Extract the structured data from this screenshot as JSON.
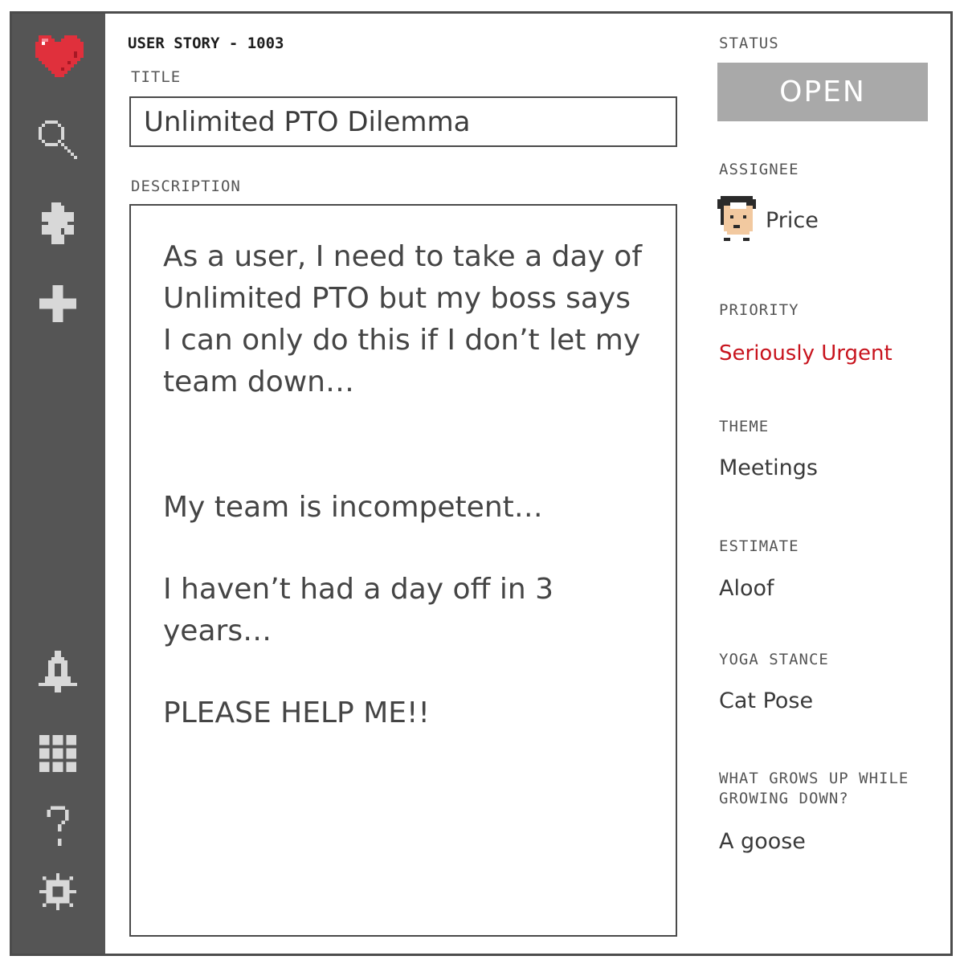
{
  "story": {
    "id": "USER STORY - 1003"
  },
  "labels": {
    "title": "TITLE",
    "description": "DESCRIPTION",
    "status": "STATUS",
    "assignee": "ASSIGNEE",
    "priority": "PRIORITY",
    "theme": "THEME",
    "estimate": "ESTIMATE",
    "yoga_stance": "YOGA STANCE",
    "riddle_line1": "WHAT GROWS UP WHILE",
    "riddle_line2": "GROWING DOWN?"
  },
  "fields": {
    "title": "Unlimited PTO Dilemma",
    "description": [
      "As a user, I need to take a day of Unlimited PTO but my boss says I can only do this if I don’t let my team down…",
      "My team is incompetent…",
      "I haven’t had a day off in 3 years…",
      "PLEASE HELP ME!!"
    ],
    "status": "OPEN",
    "assignee": "Price",
    "priority": "Seriously Urgent",
    "theme": "Meetings",
    "estimate": "Aloof",
    "yoga_stance": "Cat Pose",
    "riddle_answer": "A goose"
  },
  "sidebar": {
    "icons": [
      "heart-logo-icon",
      "search-icon",
      "puzzle-icon",
      "plus-icon",
      "bell-icon",
      "grid-icon",
      "help-icon",
      "gear-icon"
    ]
  },
  "colors": {
    "sidebar": "#555555",
    "status_bg": "#a9a9a9",
    "priority_text": "#c8141e",
    "heart": "#e0303c"
  }
}
